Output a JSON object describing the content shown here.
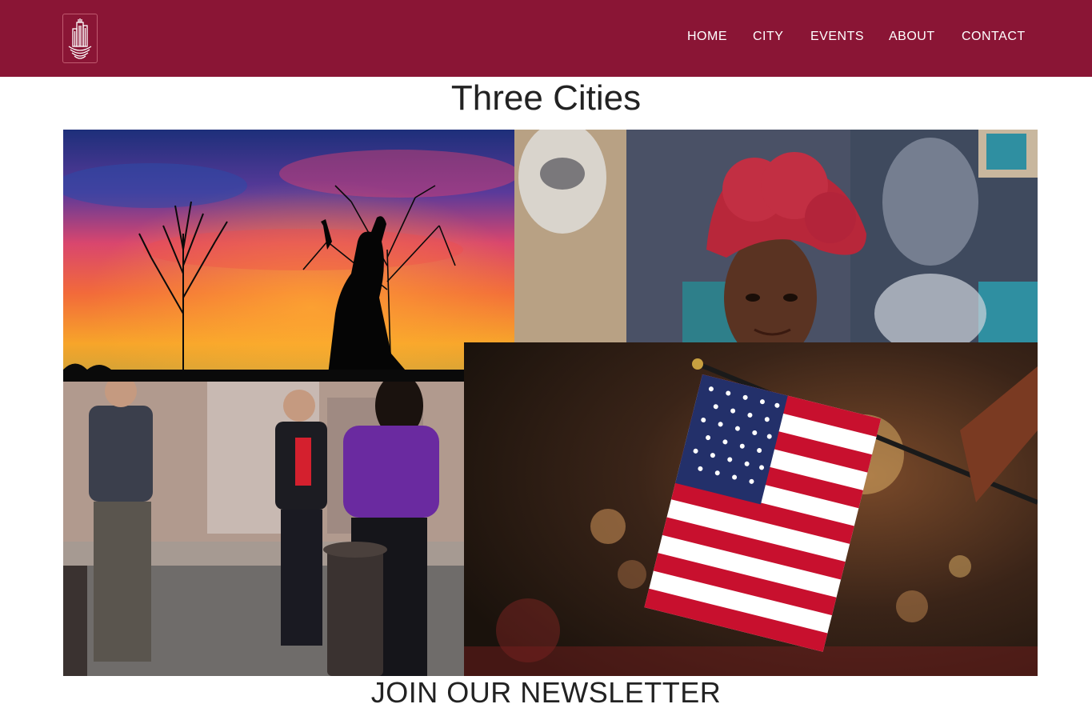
{
  "nav": {
    "logo_alt": "Three Cities logo",
    "links": [
      {
        "label": "HOME"
      },
      {
        "label": "CITY"
      },
      {
        "label": "EVENTS"
      },
      {
        "label": "ABOUT"
      },
      {
        "label": "CONTACT"
      }
    ]
  },
  "main": {
    "title": "Three Cities",
    "collage": [
      {
        "name": "sunset-statue-photo",
        "description_icon": "sunset-image"
      },
      {
        "name": "woman-mural-portrait-photo",
        "description_icon": "portrait-image"
      },
      {
        "name": "people-street-photo",
        "description_icon": "people-image"
      },
      {
        "name": "american-flag-photo",
        "description_icon": "flag-image"
      }
    ]
  },
  "newsletter": {
    "heading": "JOIN OUR NEWSLETTER"
  },
  "colors": {
    "brand": "#8a1535",
    "nav_text": "#ffffff",
    "heading_text": "#222222"
  }
}
